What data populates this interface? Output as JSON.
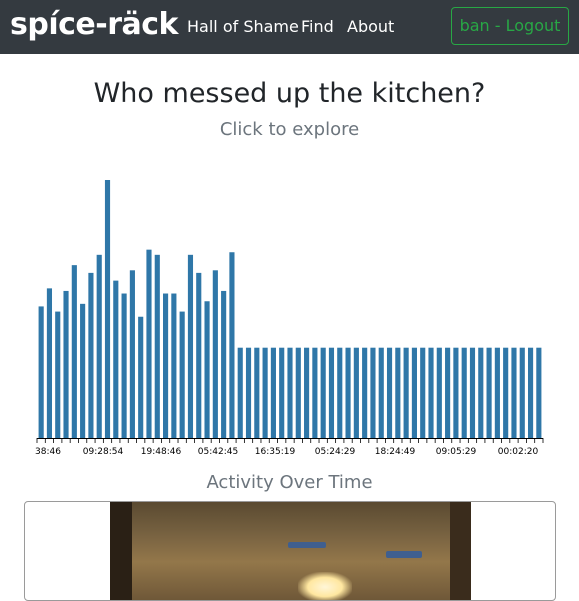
{
  "navbar": {
    "brand": "spíce-räck",
    "links": [
      "Hall of Shame",
      "Find",
      "About"
    ],
    "logout_label": "ban - Logout",
    "logout_color": "#28a745",
    "background": "#343a40"
  },
  "main": {
    "title": "Who messed up the kitchen?",
    "subtitle": "Click to explore",
    "chart_caption": "Activity Over Time"
  },
  "chart_data": {
    "type": "bar",
    "title": "",
    "xlabel": "",
    "ylabel": "",
    "bar_color": "#2f77a8",
    "grid": false,
    "legend": "none",
    "ylim": [
      0,
      100
    ],
    "tick_labels": [
      "38:46",
      "09:28:54",
      "19:48:46",
      "05:42:45",
      "16:35:19",
      "05:24:29",
      "18:24:49",
      "09:05:29",
      "00:02:20"
    ],
    "values": [
      51,
      58,
      49,
      57,
      67,
      52,
      64,
      71,
      100,
      61,
      56,
      65,
      47,
      73,
      71,
      56,
      56,
      49,
      71,
      64,
      53,
      65,
      57,
      72,
      35,
      35,
      35,
      35,
      35,
      35,
      35,
      35,
      35,
      35,
      35,
      35,
      35,
      35,
      35,
      35,
      35,
      35,
      35,
      35,
      35,
      35,
      35,
      35,
      35,
      35,
      35,
      35,
      35,
      35,
      35,
      35,
      35,
      35,
      35,
      35,
      35
    ]
  },
  "camera": {
    "description_icon": "camera-snapshot"
  }
}
